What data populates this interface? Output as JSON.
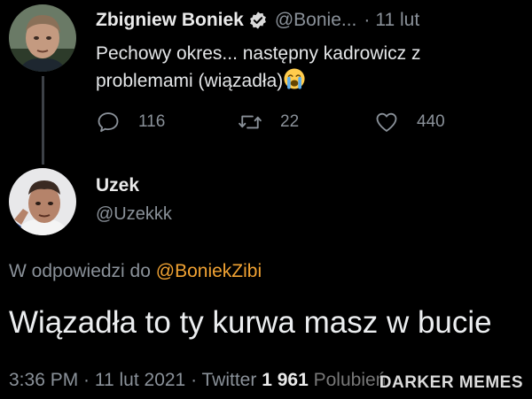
{
  "tweet": {
    "author_name": "Zbigniew Boniek",
    "author_handle": "@Bonie...",
    "separator": "·",
    "time": "11 lut",
    "text": "Pechowy okres... następny kadrowicz z problemami (wiązadła)",
    "emoji_icon": "loudly-crying-face-icon",
    "reply_count": "116",
    "retweet_count": "22",
    "like_count": "440"
  },
  "reply": {
    "author_name": "Uzek",
    "author_handle": "@Uzekkk",
    "reply_to_label": "W odpowiedzi do",
    "reply_to_handle": "@BoniekZibi",
    "text": "Wiązadła to ty kurwa masz w bucie",
    "timestamp": "3:36 PM · 11 lut 2021 · Twitter",
    "likes_count": "1 961",
    "likes_label_partial": "Polubień"
  },
  "watermark": "DARKER MEMES",
  "colors": {
    "background": "#000000",
    "muted": "#8a9199",
    "link": "#f0a233",
    "verified": "#d9d9d9"
  }
}
